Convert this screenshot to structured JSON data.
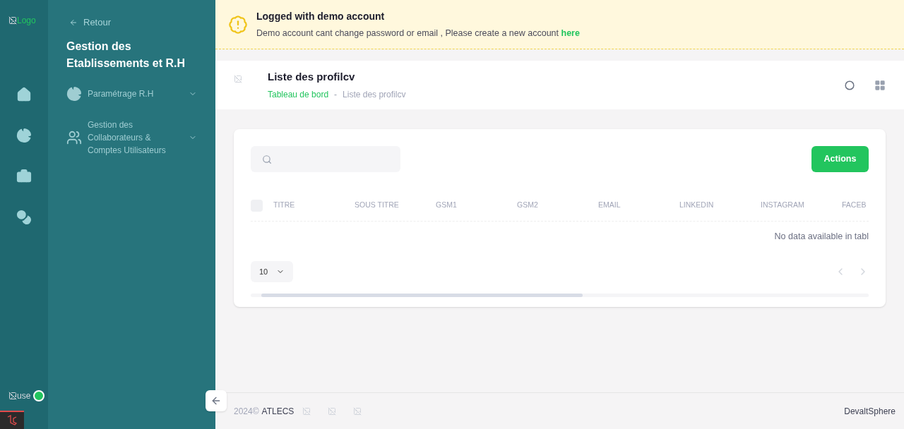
{
  "rail": {
    "logo_alt": "Logo",
    "user_alt": "use",
    "user_online": true
  },
  "sidebar": {
    "back": "Retour",
    "title": "Gestion des Etablissements et R.H",
    "items": [
      {
        "kind": "chart",
        "label": "Paramétrage R.H",
        "expanded": false
      },
      {
        "kind": "users",
        "label": "Gestion des Collaborateurs & Comptes Utilisateurs",
        "expanded": false
      }
    ]
  },
  "banner": {
    "title": "Logged with demo account",
    "message": "Demo account cant change password or email , Please create a new account ",
    "link": "here"
  },
  "toolbar": {
    "title": "Liste des profilcv",
    "separator": "-",
    "breadcrumb": [
      {
        "label": "Tableau de bord",
        "selected": false
      },
      {
        "label": "Liste des profilcv",
        "selected": true
      }
    ]
  },
  "table": {
    "actions": "Actions",
    "select_all": {
      "checked": false
    },
    "columns": [
      "TITRE",
      "SOUS TITRE",
      "GSM1",
      "GSM2",
      "EMAIL",
      "LINKEDIN",
      "INSTAGRAM",
      "FACEB"
    ],
    "empty": "No data available in tabl",
    "page_size": "10"
  },
  "footer": {
    "year": "2024©",
    "company": "ATLECS",
    "brand": "DevaltSphere"
  }
}
